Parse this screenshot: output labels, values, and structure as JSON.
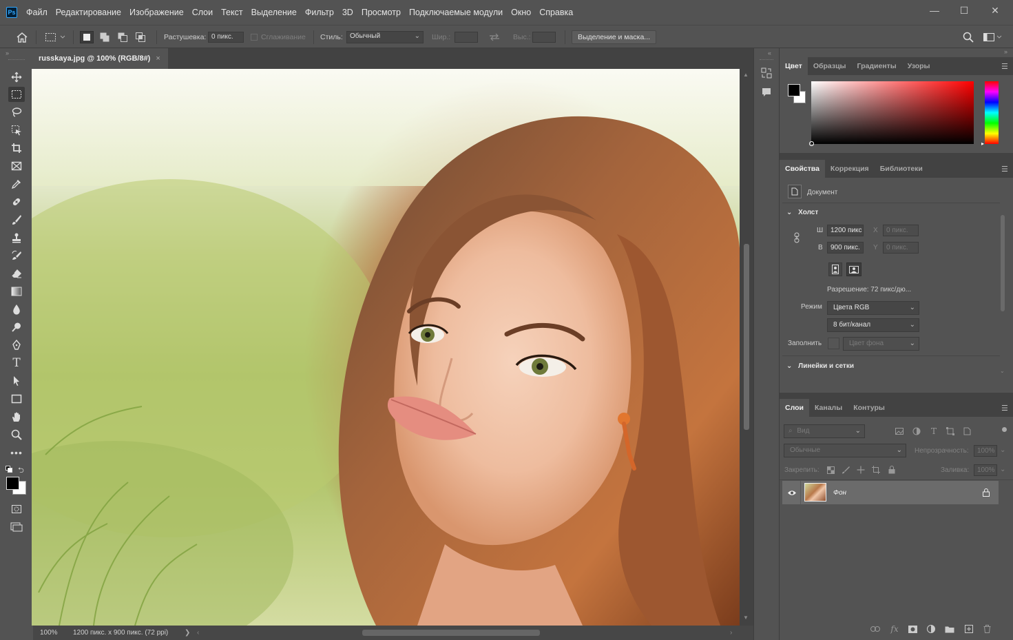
{
  "menu": {
    "logo": "Ps",
    "items": [
      "Файл",
      "Редактирование",
      "Изображение",
      "Слои",
      "Текст",
      "Выделение",
      "Фильтр",
      "3D",
      "Просмотр",
      "Подключаемые модули",
      "Окно",
      "Справка"
    ],
    "window_controls": [
      "—",
      "☐",
      "✕"
    ]
  },
  "options": {
    "feather_label": "Растушевка:",
    "feather_value": "0 пикс.",
    "antialias_label": "Сглаживание",
    "style_label": "Стиль:",
    "style_value": "Обычный",
    "width_label": "Шир.:",
    "height_label": "Выс.:",
    "mask_button": "Выделение и маска..."
  },
  "document": {
    "tab_title": "russkaya.jpg @ 100% (RGB/8#)",
    "tab_close": "×",
    "zoom": "100%",
    "info": "1200 пикс. x 900 пикс. (72 ppi)",
    "status_arrow": "❯",
    "scroll_left": "‹",
    "scroll_right": "›"
  },
  "color_panel": {
    "tabs": [
      "Цвет",
      "Образцы",
      "Градиенты",
      "Узоры"
    ],
    "foreground": "#000000",
    "background": "#ffffff",
    "hue": "#ff0000"
  },
  "properties_panel": {
    "tabs": [
      "Свойства",
      "Коррекция",
      "Библиотеки"
    ],
    "doc_label": "Документ",
    "canvas_section": "Холст",
    "w_label": "Ш",
    "w_value": "1200 пикс",
    "h_label": "В",
    "h_value": "900 пикс.",
    "x_label": "X",
    "x_value": "0 пикс.",
    "y_label": "Y",
    "y_value": "0 пикс.",
    "resolution": "Разрешение: 72 пикс/дю...",
    "mode_label": "Режим",
    "mode_value": "Цвета RGB",
    "bits_value": "8 бит/канал",
    "fill_label": "Заполнить",
    "fill_value": "Цвет фона",
    "rulers_section": "Линейки и сетки"
  },
  "layers_panel": {
    "tabs": [
      "Слои",
      "Каналы",
      "Контуры"
    ],
    "search_placeholder": "Вид",
    "blend_mode": "Обычные",
    "opacity_label": "Непрозрачность:",
    "opacity_value": "100%",
    "lock_label": "Закрепить:",
    "fill_label": "Заливка:",
    "fill_value": "100%",
    "layers": [
      {
        "name": "Фон",
        "visible": true,
        "locked": true
      }
    ]
  }
}
